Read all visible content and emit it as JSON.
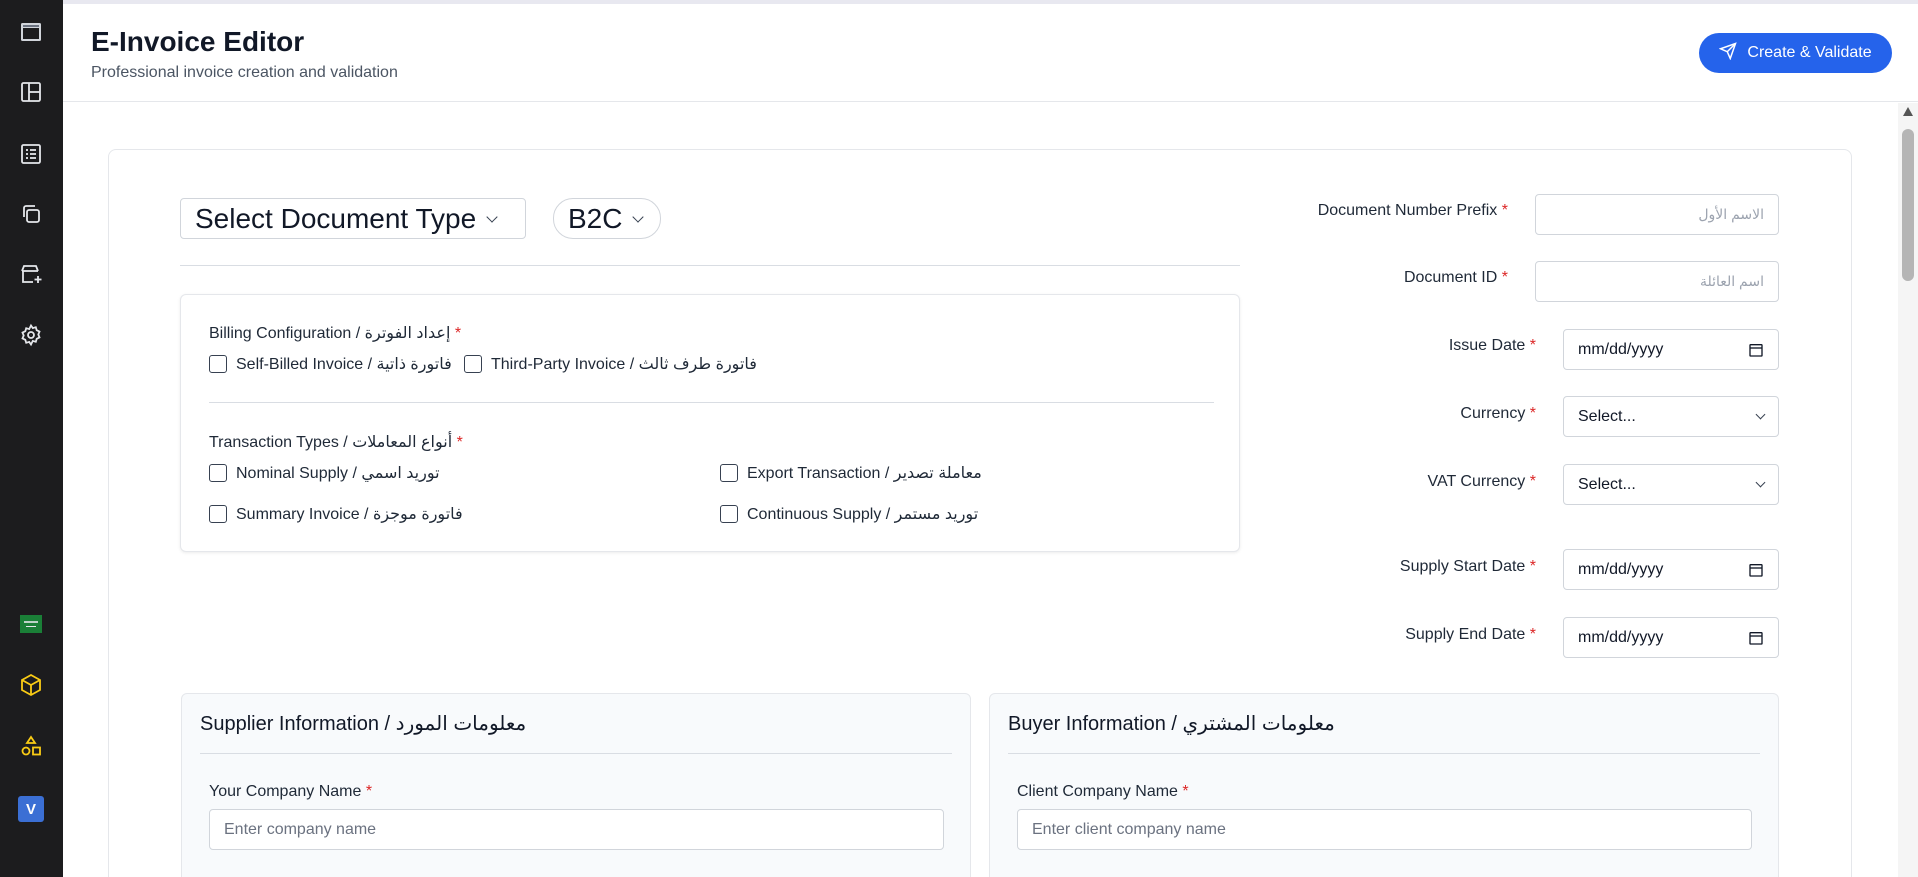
{
  "header": {
    "title": "E-Invoice Editor",
    "subtitle": "Professional invoice creation and validation",
    "create_button": "Create & Validate"
  },
  "sidebar": {
    "items": [
      {
        "icon": "window-icon"
      },
      {
        "icon": "layout-icon"
      },
      {
        "icon": "list-icon"
      },
      {
        "icon": "copy-icon"
      },
      {
        "icon": "store-add-icon"
      },
      {
        "icon": "gear-icon"
      },
      {
        "icon": "saudi-flag-icon"
      },
      {
        "icon": "cube-icon"
      },
      {
        "icon": "shapes-icon"
      },
      {
        "icon": "v-badge",
        "label": "V"
      }
    ]
  },
  "doc_type": {
    "select_label": "Select Document Type",
    "category_value": "B2C"
  },
  "billing": {
    "config_label": "Billing Configuration / إعداد الفوترة",
    "config_options": [
      "Self-Billed Invoice / فاتورة ذاتية",
      "Third-Party Invoice / فاتورة طرف ثالث"
    ],
    "transaction_label": "Transaction Types / أنواع المعاملات",
    "transaction_options": [
      "Nominal Supply / توريد اسمي",
      "Export Transaction / معاملة تصدير",
      "Summary Invoice / فاتورة موجزة",
      "Continuous Supply / توريد مستمر"
    ],
    "required_mark": "*"
  },
  "document_fields": {
    "prefix_label": "Document Number Prefix",
    "prefix_placeholder": "الاسم الأول",
    "id_label": "Document ID",
    "id_placeholder": "اسم العائلة",
    "issue_date_label": "Issue Date",
    "currency_label": "Currency",
    "vat_currency_label": "VAT Currency",
    "supply_start_label": "Supply Start Date",
    "supply_end_label": "Supply End Date",
    "date_placeholder": "mm/dd/yyyy",
    "select_placeholder": "Select..."
  },
  "supplier": {
    "title": "Supplier Information / معلومات المورد",
    "company_label": "Your Company Name",
    "company_placeholder": "Enter company name"
  },
  "buyer": {
    "title": "Buyer Information / معلومات المشتري",
    "company_label": "Client Company Name",
    "company_placeholder": "Enter client company name"
  },
  "colors": {
    "sidebar_bg": "#1c1c1e",
    "accent": "#2563eb",
    "required": "#dc2626"
  }
}
